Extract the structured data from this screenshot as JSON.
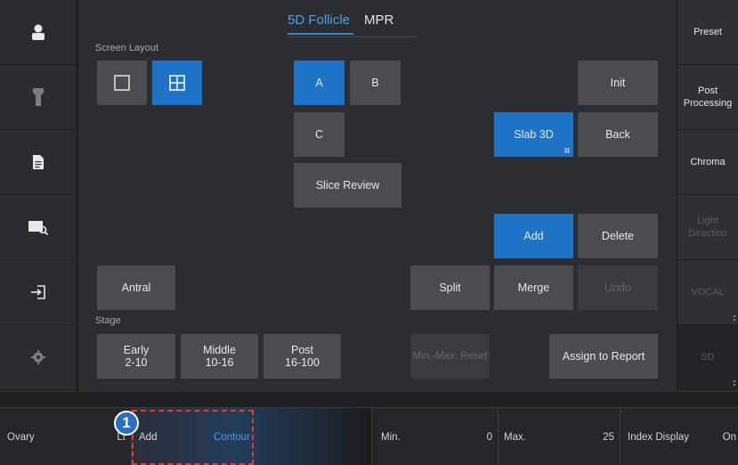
{
  "tabs": [
    {
      "label": "5D Follicle"
    },
    {
      "label": "MPR"
    }
  ],
  "screen_layout": {
    "label": "Screen Layout"
  },
  "stage": {
    "label": "Stage"
  },
  "buttons": {
    "a": "A",
    "b": "B",
    "c": "C",
    "slice_review": "Slice Review",
    "init": "Init",
    "slab3d": "Slab 3D",
    "back": "Back",
    "add": "Add",
    "delete": "Delete",
    "antral": "Antral",
    "split": "Split",
    "merge": "Merge",
    "undo": "Undo",
    "early_name": "Early",
    "early_range": "2-10",
    "middle_name": "Middle",
    "middle_range": "10-16",
    "post_name": "Post",
    "post_range": "16-100",
    "minmax_reset": "Min.-Max. Reset",
    "assign": "Assign to Report"
  },
  "right_menu": {
    "preset": "Preset",
    "post_processing_1": "Post",
    "post_processing_2": "Processing",
    "chroma": "Chroma",
    "light_1": "Light",
    "light_2": "Direction",
    "vocal": "VOCAL",
    "sd": "SD"
  },
  "left_icons": [
    "user-icon",
    "probe-icon",
    "document-icon",
    "image-search-icon",
    "exit-icon",
    "gear-icon"
  ],
  "bottom": {
    "ovary_label": "Ovary",
    "ovary_value": "Lt",
    "add_label": "Add",
    "contour_label": "Contour",
    "min_label": "Min.",
    "min_value": "0",
    "max_label": "Max.",
    "max_value": "25",
    "index_label": "Index Display",
    "index_value": "On"
  },
  "annotation": {
    "number": "1"
  },
  "colors": {
    "accent": "#1f73c7",
    "annotation": "#e53a3a"
  }
}
